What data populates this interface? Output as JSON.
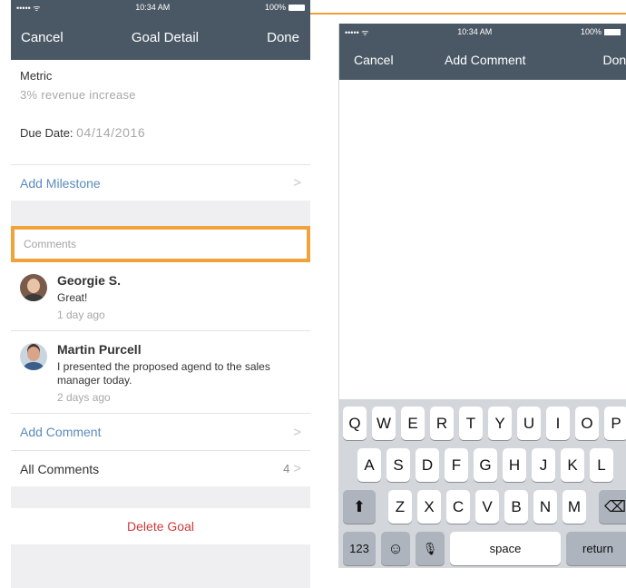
{
  "phone1": {
    "status": {
      "carrier": "••••• ᯤ",
      "time": "10:34 AM",
      "battery": "100%"
    },
    "nav": {
      "cancel": "Cancel",
      "title": "Goal Detail",
      "done": "Done"
    },
    "metric": {
      "label": "Metric",
      "value": "3% revenue increase"
    },
    "due": {
      "label": "Due Date:",
      "value": "04/14/2016"
    },
    "add_milestone": "Add Milestone",
    "comments_header": "Comments",
    "comments": [
      {
        "name": "Georgie S.",
        "text": "Great!",
        "time": "1 day ago"
      },
      {
        "name": "Martin Purcell",
        "text": "I presented the proposed agend to the sales manager today.",
        "time": "2 days ago"
      }
    ],
    "add_comment": "Add Comment",
    "all_comments": {
      "label": "All Comments",
      "count": "4"
    },
    "delete_goal": "Delete Goal",
    "chevron": ">"
  },
  "phone2": {
    "status": {
      "carrier": "••••• ᯤ",
      "time": "10:34 AM",
      "battery": "100%"
    },
    "nav": {
      "cancel": "Cancel",
      "title": "Add Comment",
      "done": "Done"
    },
    "keyboard": {
      "row1": [
        "Q",
        "W",
        "E",
        "R",
        "T",
        "Y",
        "U",
        "I",
        "O",
        "P"
      ],
      "row2": [
        "A",
        "S",
        "D",
        "F",
        "G",
        "H",
        "J",
        "K",
        "L"
      ],
      "row3": [
        "Z",
        "X",
        "C",
        "V",
        "B",
        "N",
        "M"
      ],
      "shift": "⬆",
      "backspace": "⌫",
      "numbers": "123",
      "emoji": "☺",
      "mic": "🎙",
      "space": "space",
      "return": "return"
    }
  },
  "colors": {
    "navbar": "#4a5865",
    "link": "#5a8bbd",
    "highlight": "#f0a33a",
    "destructive": "#d0393b"
  }
}
